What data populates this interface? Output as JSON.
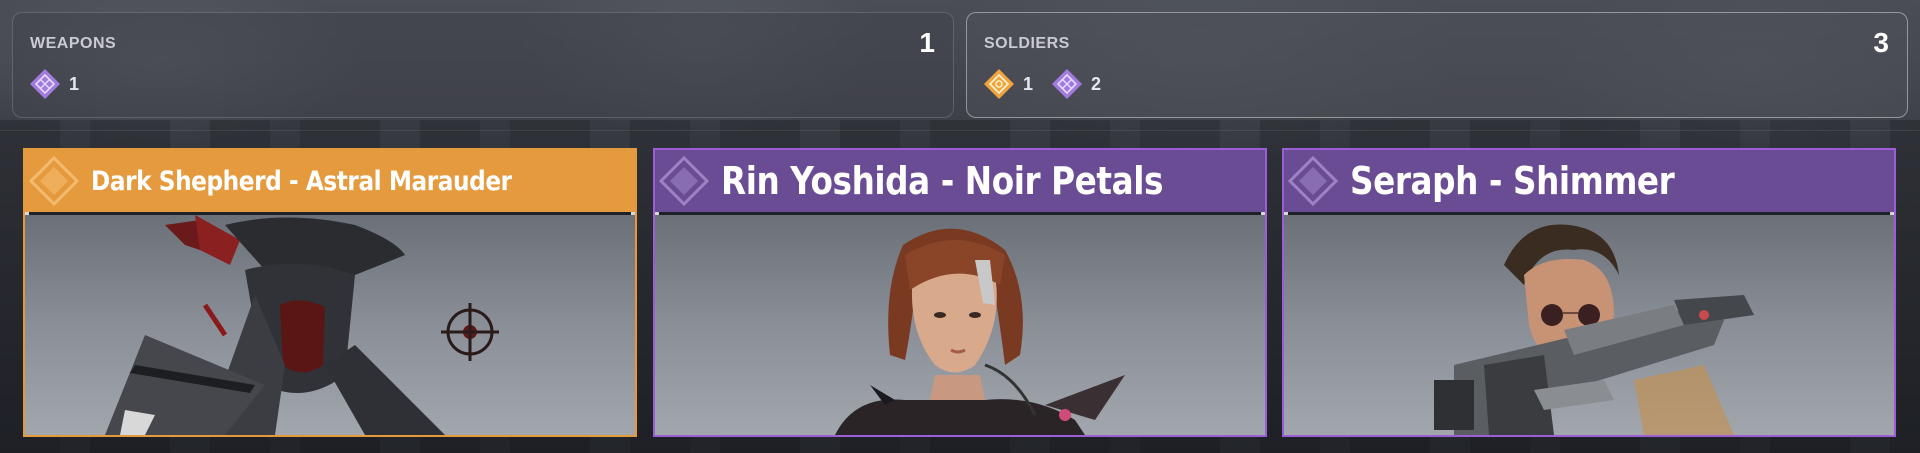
{
  "summary": {
    "weapons": {
      "title": "WEAPONS",
      "count": "1",
      "rarities": [
        {
          "rarity": "epic",
          "color": "#a27be0",
          "count": "1"
        }
      ]
    },
    "soldiers": {
      "title": "SOLDIERS",
      "count": "3",
      "rarities": [
        {
          "rarity": "legendary",
          "color": "#f0a43c",
          "count": "1"
        },
        {
          "rarity": "epic",
          "color": "#a27be0",
          "count": "2"
        }
      ]
    }
  },
  "cards": [
    {
      "name": "Dark Shepherd - Astral Marauder",
      "rarity": "legendary",
      "color": "#e59a3e",
      "icon": "rarity-gem-icon",
      "portrait": "dark-armored-pirate-soldier"
    },
    {
      "name": "Rin Yoshida - Noir Petals",
      "rarity": "epic",
      "color": "#6a4c95",
      "icon": "rarity-gem-icon",
      "portrait": "red-haired-woman-soldier"
    },
    {
      "name": "Seraph - Shimmer",
      "rarity": "epic",
      "color": "#6a4c95",
      "icon": "rarity-gem-icon",
      "portrait": "sunglasses-soldier-with-gun"
    }
  ]
}
